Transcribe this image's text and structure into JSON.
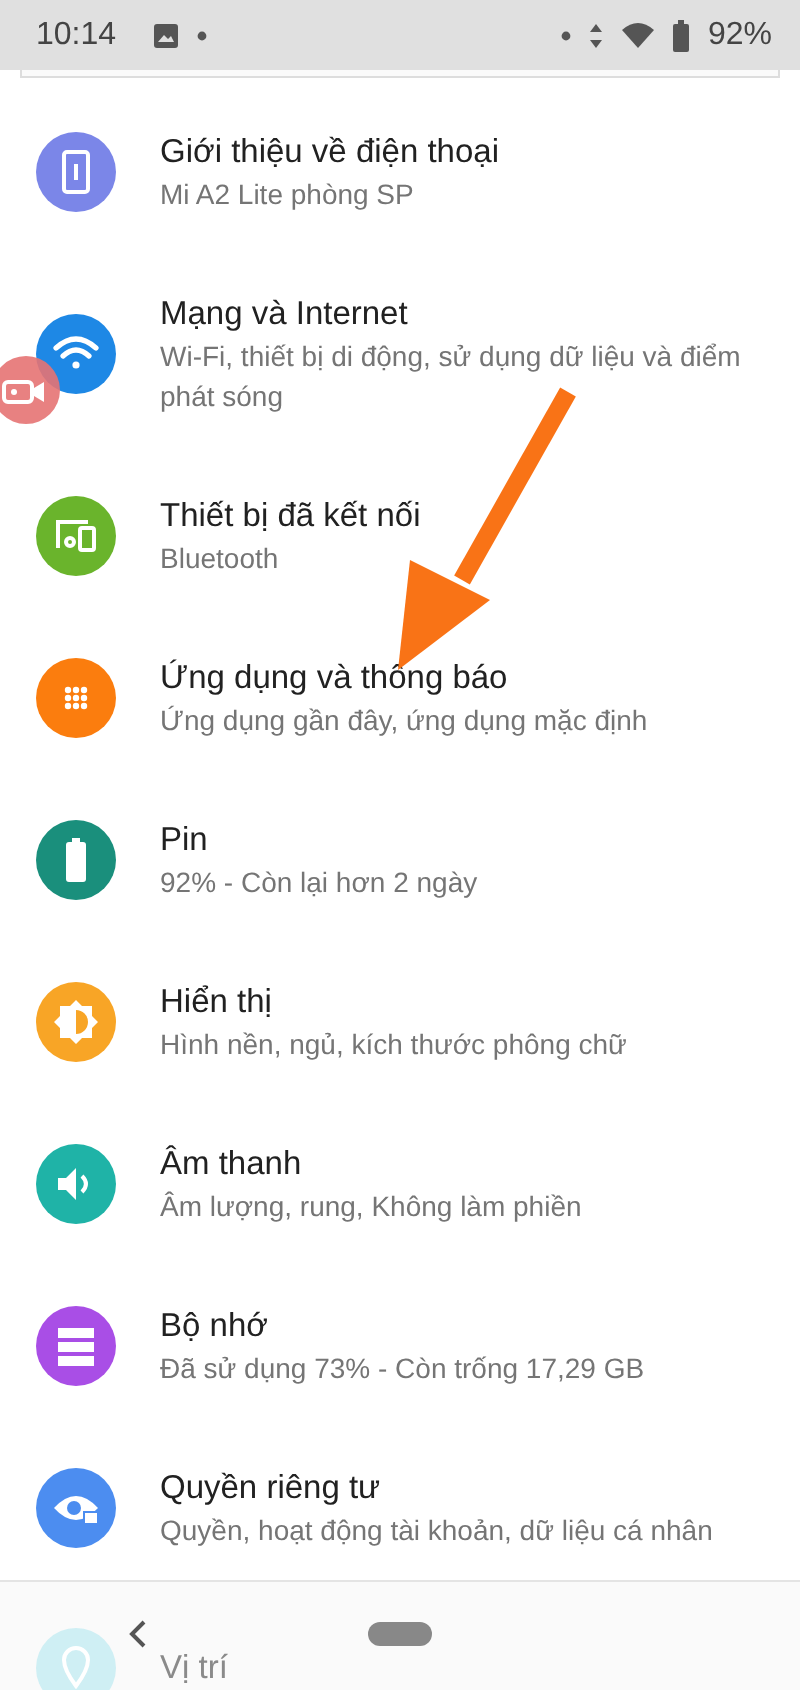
{
  "status_bar": {
    "time": "10:14",
    "battery": "92%"
  },
  "settings": [
    {
      "title": "Giới thiệu về điện thoại",
      "subtitle": "Mi A2 Lite phòng SP",
      "kind": "phone",
      "color": "#7b86e8"
    },
    {
      "title": "Mạng và Internet",
      "subtitle": "Wi-Fi, thiết bị di động, sử dụng dữ liệu và điểm phát sóng",
      "kind": "wifi",
      "color": "#1e88e5"
    },
    {
      "title": "Thiết bị đã kết nối",
      "subtitle": "Bluetooth",
      "kind": "devices",
      "color": "#6ab42c"
    },
    {
      "title": "Ứng dụng và thông báo",
      "subtitle": "Ứng dụng gần đây, ứng dụng mặc định",
      "kind": "apps",
      "color": "#fb7d0e"
    },
    {
      "title": "Pin",
      "subtitle": "92% - Còn lại hơn 2 ngày",
      "kind": "battery",
      "color": "#1a8f7c"
    },
    {
      "title": "Hiển thị",
      "subtitle": "Hình nền, ngủ, kích thước phông chữ",
      "kind": "display",
      "color": "#f8a526"
    },
    {
      "title": "Âm thanh",
      "subtitle": "Âm lượng, rung, Không làm phiền",
      "kind": "sound",
      "color": "#1fb3a7"
    },
    {
      "title": "Bộ nhớ",
      "subtitle": "Đã sử dụng 73% - Còn trống 17,29 GB",
      "kind": "storage",
      "color": "#a94ee6"
    },
    {
      "title": "Quyền riêng tư",
      "subtitle": "Quyền, hoạt động tài khoản, dữ liệu cá nhân",
      "kind": "privacy",
      "color": "#4c8df0"
    },
    {
      "title": "Vị trí",
      "kind": "location",
      "color": "#cfeff4"
    }
  ]
}
